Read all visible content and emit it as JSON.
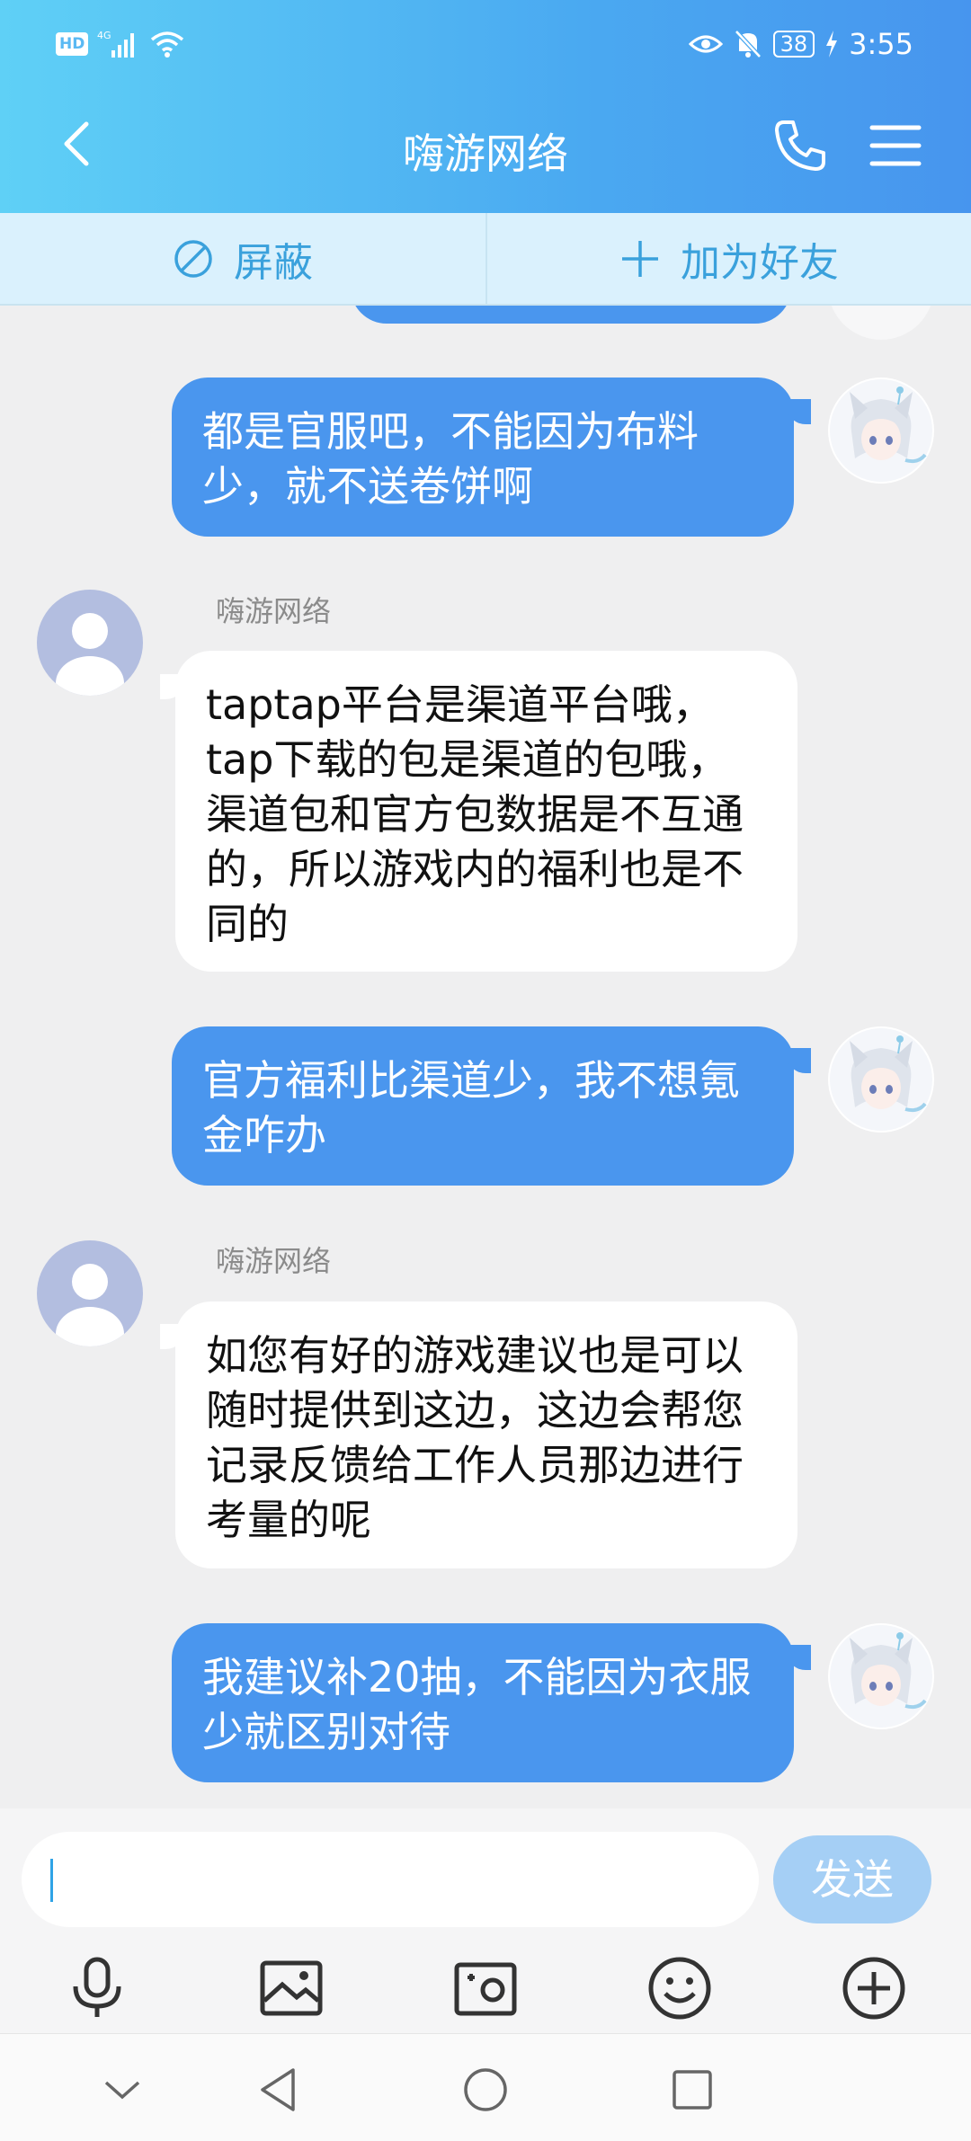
{
  "status_bar": {
    "hd": "HD",
    "network": "4G",
    "battery": "38",
    "time": "3:55"
  },
  "header": {
    "title": "嗨游网络"
  },
  "actions": {
    "block_label": "屏蔽",
    "add_friend_label": "加为好友"
  },
  "messages": [
    {
      "from": "me",
      "text": "都是官服吧，不能因为布料少，就不送卷饼啊"
    },
    {
      "from": "them",
      "sender": "嗨游网络",
      "text": "taptap平台是渠道平台哦，tap下载的包是渠道的包哦，渠道包和官方包数据是不互通的，所以游戏内的福利也是不同的"
    },
    {
      "from": "me",
      "text": "官方福利比渠道少，我不想氪金咋办"
    },
    {
      "from": "them",
      "sender": "嗨游网络",
      "text": "如您有好的游戏建议也是可以随时提供到这边，这边会帮您记录反馈给工作人员那边进行考量的呢"
    },
    {
      "from": "me",
      "text": "我建议补20抽，不能因为衣服少就区别对待"
    }
  ],
  "input": {
    "value": "",
    "send_label": "发送"
  },
  "toolbar_icons": [
    "microphone-icon",
    "image-icon",
    "camera-icon",
    "emoji-icon",
    "plus-icon"
  ],
  "colors": {
    "accent": "#4a96ee",
    "header_start": "#5fd0f6",
    "header_end": "#4795ee",
    "action_bar": "#daf1fd",
    "send_disabled": "#a5cff5"
  }
}
